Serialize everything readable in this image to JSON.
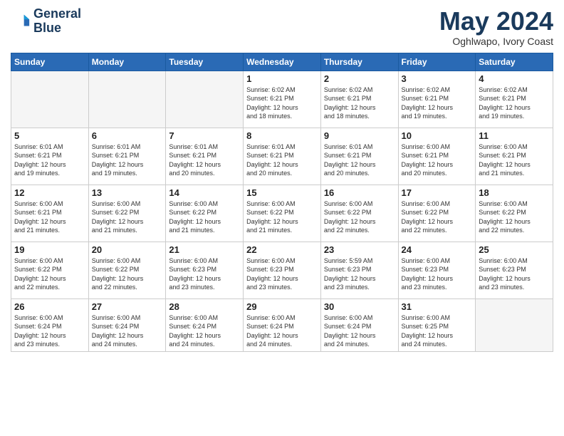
{
  "header": {
    "logo_line1": "General",
    "logo_line2": "Blue",
    "title": "May 2024",
    "subtitle": "Oghlwapo, Ivory Coast"
  },
  "days_of_week": [
    "Sunday",
    "Monday",
    "Tuesday",
    "Wednesday",
    "Thursday",
    "Friday",
    "Saturday"
  ],
  "weeks": [
    [
      {
        "day": "",
        "info": ""
      },
      {
        "day": "",
        "info": ""
      },
      {
        "day": "",
        "info": ""
      },
      {
        "day": "1",
        "info": "Sunrise: 6:02 AM\nSunset: 6:21 PM\nDaylight: 12 hours\nand 18 minutes."
      },
      {
        "day": "2",
        "info": "Sunrise: 6:02 AM\nSunset: 6:21 PM\nDaylight: 12 hours\nand 18 minutes."
      },
      {
        "day": "3",
        "info": "Sunrise: 6:02 AM\nSunset: 6:21 PM\nDaylight: 12 hours\nand 19 minutes."
      },
      {
        "day": "4",
        "info": "Sunrise: 6:02 AM\nSunset: 6:21 PM\nDaylight: 12 hours\nand 19 minutes."
      }
    ],
    [
      {
        "day": "5",
        "info": "Sunrise: 6:01 AM\nSunset: 6:21 PM\nDaylight: 12 hours\nand 19 minutes."
      },
      {
        "day": "6",
        "info": "Sunrise: 6:01 AM\nSunset: 6:21 PM\nDaylight: 12 hours\nand 19 minutes."
      },
      {
        "day": "7",
        "info": "Sunrise: 6:01 AM\nSunset: 6:21 PM\nDaylight: 12 hours\nand 20 minutes."
      },
      {
        "day": "8",
        "info": "Sunrise: 6:01 AM\nSunset: 6:21 PM\nDaylight: 12 hours\nand 20 minutes."
      },
      {
        "day": "9",
        "info": "Sunrise: 6:01 AM\nSunset: 6:21 PM\nDaylight: 12 hours\nand 20 minutes."
      },
      {
        "day": "10",
        "info": "Sunrise: 6:00 AM\nSunset: 6:21 PM\nDaylight: 12 hours\nand 20 minutes."
      },
      {
        "day": "11",
        "info": "Sunrise: 6:00 AM\nSunset: 6:21 PM\nDaylight: 12 hours\nand 21 minutes."
      }
    ],
    [
      {
        "day": "12",
        "info": "Sunrise: 6:00 AM\nSunset: 6:21 PM\nDaylight: 12 hours\nand 21 minutes."
      },
      {
        "day": "13",
        "info": "Sunrise: 6:00 AM\nSunset: 6:22 PM\nDaylight: 12 hours\nand 21 minutes."
      },
      {
        "day": "14",
        "info": "Sunrise: 6:00 AM\nSunset: 6:22 PM\nDaylight: 12 hours\nand 21 minutes."
      },
      {
        "day": "15",
        "info": "Sunrise: 6:00 AM\nSunset: 6:22 PM\nDaylight: 12 hours\nand 21 minutes."
      },
      {
        "day": "16",
        "info": "Sunrise: 6:00 AM\nSunset: 6:22 PM\nDaylight: 12 hours\nand 22 minutes."
      },
      {
        "day": "17",
        "info": "Sunrise: 6:00 AM\nSunset: 6:22 PM\nDaylight: 12 hours\nand 22 minutes."
      },
      {
        "day": "18",
        "info": "Sunrise: 6:00 AM\nSunset: 6:22 PM\nDaylight: 12 hours\nand 22 minutes."
      }
    ],
    [
      {
        "day": "19",
        "info": "Sunrise: 6:00 AM\nSunset: 6:22 PM\nDaylight: 12 hours\nand 22 minutes."
      },
      {
        "day": "20",
        "info": "Sunrise: 6:00 AM\nSunset: 6:22 PM\nDaylight: 12 hours\nand 22 minutes."
      },
      {
        "day": "21",
        "info": "Sunrise: 6:00 AM\nSunset: 6:23 PM\nDaylight: 12 hours\nand 23 minutes."
      },
      {
        "day": "22",
        "info": "Sunrise: 6:00 AM\nSunset: 6:23 PM\nDaylight: 12 hours\nand 23 minutes."
      },
      {
        "day": "23",
        "info": "Sunrise: 5:59 AM\nSunset: 6:23 PM\nDaylight: 12 hours\nand 23 minutes."
      },
      {
        "day": "24",
        "info": "Sunrise: 6:00 AM\nSunset: 6:23 PM\nDaylight: 12 hours\nand 23 minutes."
      },
      {
        "day": "25",
        "info": "Sunrise: 6:00 AM\nSunset: 6:23 PM\nDaylight: 12 hours\nand 23 minutes."
      }
    ],
    [
      {
        "day": "26",
        "info": "Sunrise: 6:00 AM\nSunset: 6:24 PM\nDaylight: 12 hours\nand 23 minutes."
      },
      {
        "day": "27",
        "info": "Sunrise: 6:00 AM\nSunset: 6:24 PM\nDaylight: 12 hours\nand 24 minutes."
      },
      {
        "day": "28",
        "info": "Sunrise: 6:00 AM\nSunset: 6:24 PM\nDaylight: 12 hours\nand 24 minutes."
      },
      {
        "day": "29",
        "info": "Sunrise: 6:00 AM\nSunset: 6:24 PM\nDaylight: 12 hours\nand 24 minutes."
      },
      {
        "day": "30",
        "info": "Sunrise: 6:00 AM\nSunset: 6:24 PM\nDaylight: 12 hours\nand 24 minutes."
      },
      {
        "day": "31",
        "info": "Sunrise: 6:00 AM\nSunset: 6:25 PM\nDaylight: 12 hours\nand 24 minutes."
      },
      {
        "day": "",
        "info": ""
      }
    ]
  ]
}
